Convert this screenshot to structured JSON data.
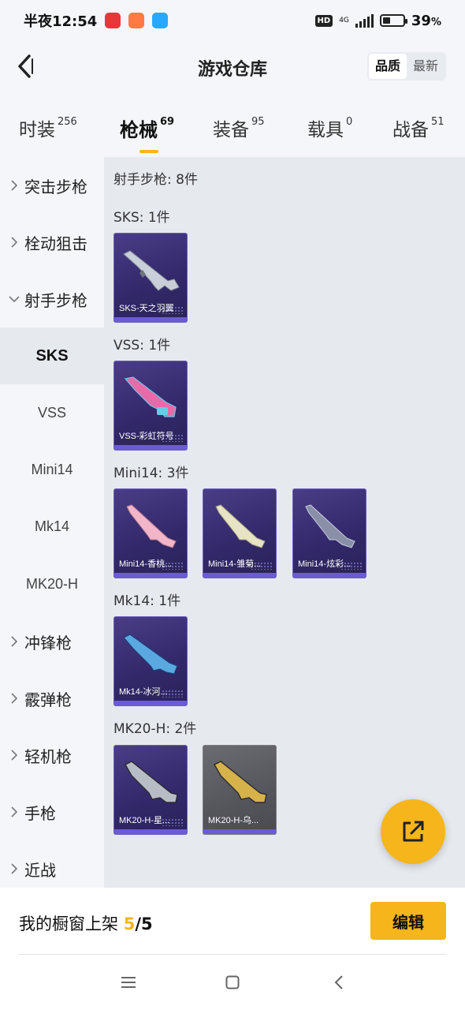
{
  "status_bar": {
    "time": "半夜12:54",
    "network_type": "4G",
    "hd_label": "HD",
    "battery_percent": "39",
    "battery_level": 0.39,
    "battery_suffix": "%",
    "app_icon_colors": [
      "#e8363b",
      "#ff7a45",
      "#29a8ff"
    ]
  },
  "header": {
    "title": "游戏仓库",
    "sort_options": [
      "品质",
      "最新"
    ],
    "sort_selected": "品质"
  },
  "tabs": [
    {
      "label": "时装",
      "count": "256"
    },
    {
      "label": "枪械",
      "count": "69",
      "active": true
    },
    {
      "label": "装备",
      "count": "95"
    },
    {
      "label": "载具",
      "count": "0"
    },
    {
      "label": "战备",
      "count": "51"
    }
  ],
  "sidebar": {
    "categories": [
      "突击步枪",
      "栓动狙击",
      "射手步枪",
      "冲锋枪",
      "霰弹枪",
      "轻机枪",
      "手枪",
      "近战"
    ],
    "expanded": "射手步枪",
    "subcategories": [
      "SKS",
      "VSS",
      "Mini14",
      "Mk14",
      "MK20-H"
    ],
    "active_sub": "SKS"
  },
  "content": {
    "group_title": "射手步枪: 8件",
    "sections": [
      {
        "title": "SKS: 1件",
        "items": [
          {
            "name": "SKS-天之羽翼",
            "icon": "rifle-sks"
          }
        ]
      },
      {
        "title": "VSS: 1件",
        "items": [
          {
            "name": "VSS-彩虹符号",
            "icon": "rifle-vss"
          }
        ]
      },
      {
        "title": "Mini14: 3件",
        "items": [
          {
            "name": "Mini14-香桃...",
            "icon": "rifle-mini14-pink"
          },
          {
            "name": "Mini14-雏菊...",
            "icon": "rifle-mini14-cream"
          },
          {
            "name": "Mini14-炫彩...",
            "icon": "rifle-mini14-dark"
          }
        ]
      },
      {
        "title": "Mk14: 1件",
        "items": [
          {
            "name": "Mk14-冰河...",
            "icon": "rifle-mk14"
          }
        ]
      },
      {
        "title": "MK20-H: 2件",
        "items": [
          {
            "name": "MK20-H-星...",
            "icon": "rifle-mk20-dark"
          },
          {
            "name": "MK20-H-乌...",
            "icon": "rifle-mk20-gold"
          }
        ]
      }
    ]
  },
  "footer": {
    "showcase_label": "我的橱窗上架",
    "showcase_count": "5",
    "showcase_total": "/5",
    "edit_label": "编辑"
  },
  "colors": {
    "accent": "#f6b51b",
    "card_bg": "#3a2f78",
    "card_bar": "#6a5bd6",
    "page_bg": "#f4f6fa",
    "content_bg": "#e6e9ee"
  }
}
